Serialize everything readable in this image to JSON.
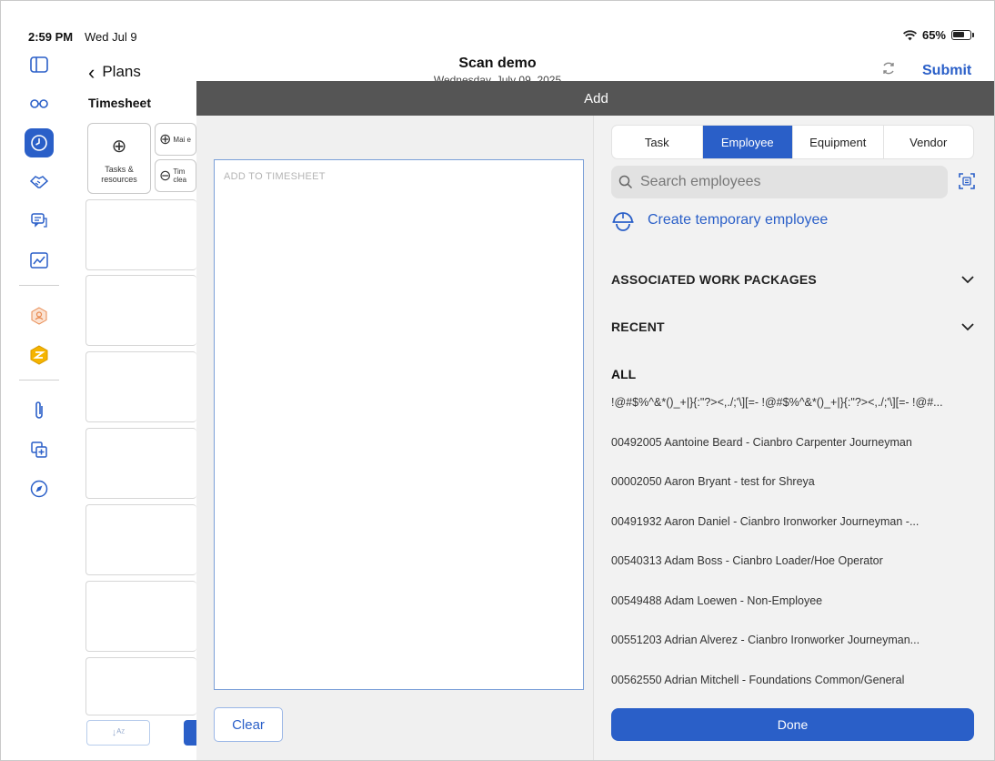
{
  "status_bar": {
    "time": "2:59 PM",
    "date": "Wed Jul 9",
    "battery": "65%"
  },
  "header": {
    "back_label": "Plans",
    "title": "Scan demo",
    "subtitle": "Wednesday, July 09, 2025",
    "submit_label": "Submit"
  },
  "timesheet": {
    "label": "Timesheet",
    "tasks_resources_label": "Tasks & resources",
    "mini_card_1": "Mai e",
    "mini_card_2": "Tim clea"
  },
  "rail": {
    "icons": [
      "sidebar-toggle-icon",
      "glasses-icon",
      "clock-icon",
      "handshake-icon",
      "chat-icon",
      "chart-icon",
      "user-badge-icon",
      "hex-logo-icon",
      "paperclip-icon",
      "add-layer-icon",
      "compass-icon"
    ]
  },
  "modal": {
    "title": "Add",
    "drop_placeholder": "ADD TO TIMESHEET",
    "clear_label": "Clear",
    "tabs": [
      "Task",
      "Employee",
      "Equipment",
      "Vendor"
    ],
    "active_tab": "Employee",
    "search_placeholder": "Search employees",
    "create_temp_label": "Create temporary employee",
    "sections": {
      "associated": "ASSOCIATED WORK PACKAGES",
      "recent": "RECENT",
      "all": "ALL"
    },
    "employees": [
      "!@#$%^&*()_+|}{:\"?><,./;'\\][=- !@#$%^&*()_+|}{:\"?><,./;'\\][=- !@#...",
      "00492005 Aantoine Beard - Cianbro Carpenter Journeyman",
      "00002050 Aaron Bryant - test for Shreya",
      "00491932 Aaron Daniel - Cianbro Ironworker Journeyman -...",
      "00540313 Adam Boss - Cianbro Loader/Hoe Operator",
      "00549488 Adam Loewen - Non-Employee",
      "00551203 Adrian Alverez - Cianbro Ironworker Journeyman...",
      "00562550 Adrian Mitchell - Foundations Common/General"
    ],
    "done_label": "Done"
  },
  "colors": {
    "accent": "#2a5fc8",
    "modal_bar": "#555555"
  }
}
